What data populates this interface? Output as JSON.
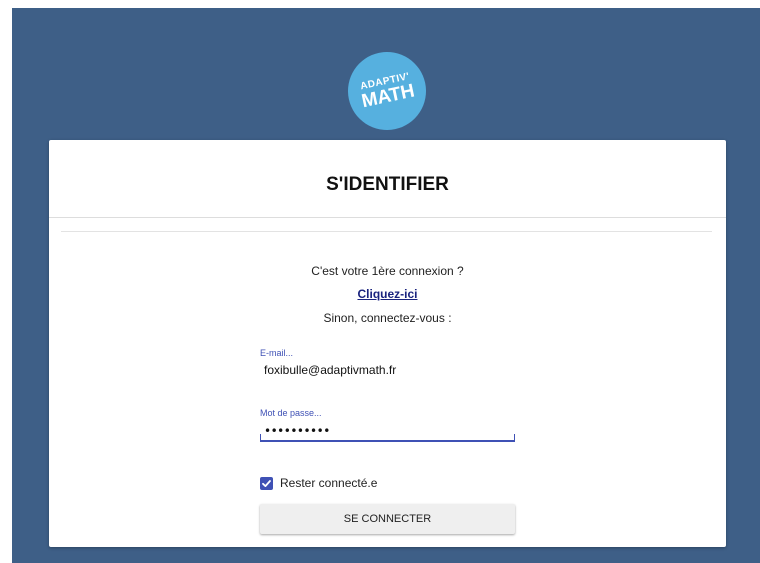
{
  "logo": {
    "line1": "ADAPTIV'",
    "line2": "MATH"
  },
  "card": {
    "title": "S'IDENTIFIER",
    "first_connection_text": "C'est votre 1ère connexion ?",
    "first_connection_link": "Cliquez-ici",
    "otherwise_text": "Sinon, connectez-vous :"
  },
  "form": {
    "email": {
      "label": "E-mail...",
      "value": "foxibulle@adaptivmath.fr"
    },
    "password": {
      "label": "Mot de passe...",
      "masked_value": "••••••••••"
    },
    "remember": {
      "label": "Rester connecté.e",
      "checked": true
    },
    "submit_label": "SE CONNECTER"
  },
  "colors": {
    "background": "#3e5f87",
    "logo": "#56b0df",
    "accent": "#3f51b5",
    "link": "#1a237e"
  }
}
